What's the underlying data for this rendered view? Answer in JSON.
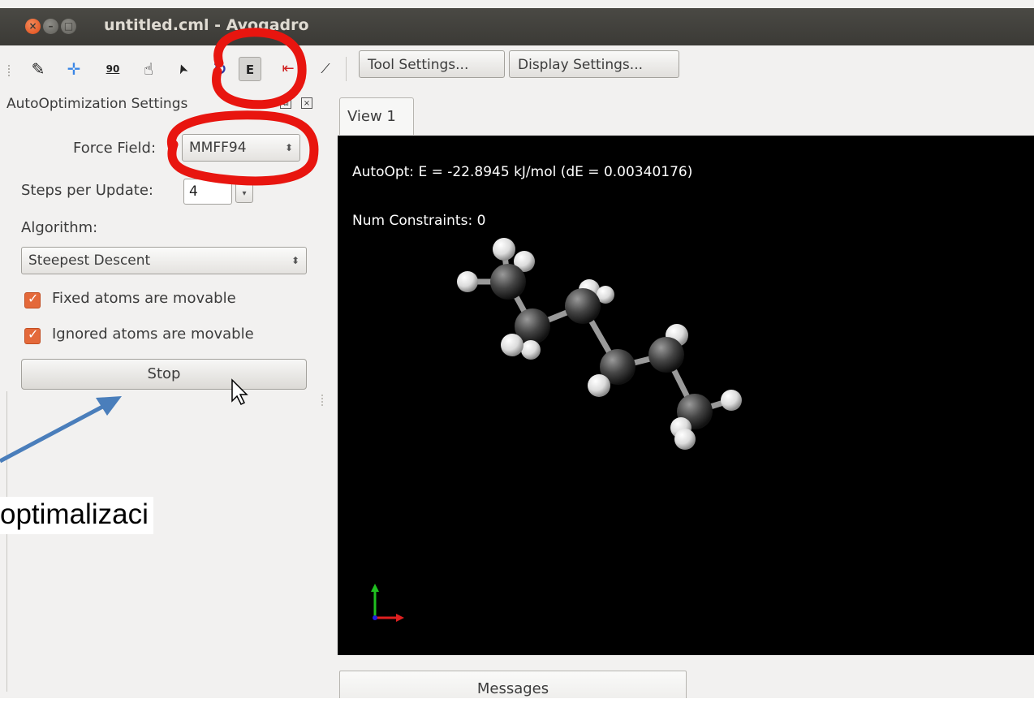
{
  "window": {
    "title": "untitled.cml - Avogadro"
  },
  "toolbar": {
    "tools": [
      {
        "name": "draw-tool",
        "icon": "pencil-icon",
        "glyph": "✎"
      },
      {
        "name": "navigate-tool",
        "icon": "crosshair-icon",
        "glyph": "✛"
      },
      {
        "name": "bond-centric-tool",
        "icon": "angle-90-icon",
        "glyph": "90"
      },
      {
        "name": "manipulate-tool",
        "icon": "hand-icon",
        "glyph": "☝"
      },
      {
        "name": "select-tool",
        "icon": "arrow-cursor-icon",
        "glyph": "➤"
      },
      {
        "name": "rotate-tool",
        "icon": "rotate-icon",
        "glyph": "↻"
      },
      {
        "name": "autooptimize-tool",
        "icon": "energy-e-icon",
        "glyph": "E"
      },
      {
        "name": "measure-tool",
        "icon": "measure-icon",
        "glyph": "⇤"
      },
      {
        "name": "align-tool",
        "icon": "align-icon",
        "glyph": "⟋"
      }
    ],
    "tool_settings": "Tool Settings...",
    "display_settings": "Display Settings..."
  },
  "dock": {
    "title": "AutoOptimization Settings",
    "force_field_label": "Force Field:",
    "force_field_value": "MMFF94",
    "steps_label": "Steps per Update:",
    "steps_value": "4",
    "algorithm_label": "Algorithm:",
    "algorithm_value": "Steepest Descent",
    "fixed_atoms_label": "Fixed atoms are movable",
    "fixed_atoms_checked": true,
    "ignored_atoms_label": "Ignored atoms are movable",
    "ignored_atoms_checked": true,
    "stop_label": "Stop"
  },
  "view": {
    "tab_label": "View 1",
    "energy_text": "AutoOpt: E = -22.8945 kJ/mol (dE = 0.00340176)",
    "constraints_text": "Num Constraints: 0",
    "background": "#000000",
    "carbon_color": "#444444",
    "hydrogen_color": "#eeeeee",
    "axis_colors": {
      "x": "#e02020",
      "y": "#20c020",
      "z": "#2020e0"
    }
  },
  "messages_label": "Messages",
  "annotation": {
    "text": "optimalizaci",
    "highlight_color": "#e8150f",
    "arrow_color": "#4a7ebb"
  }
}
